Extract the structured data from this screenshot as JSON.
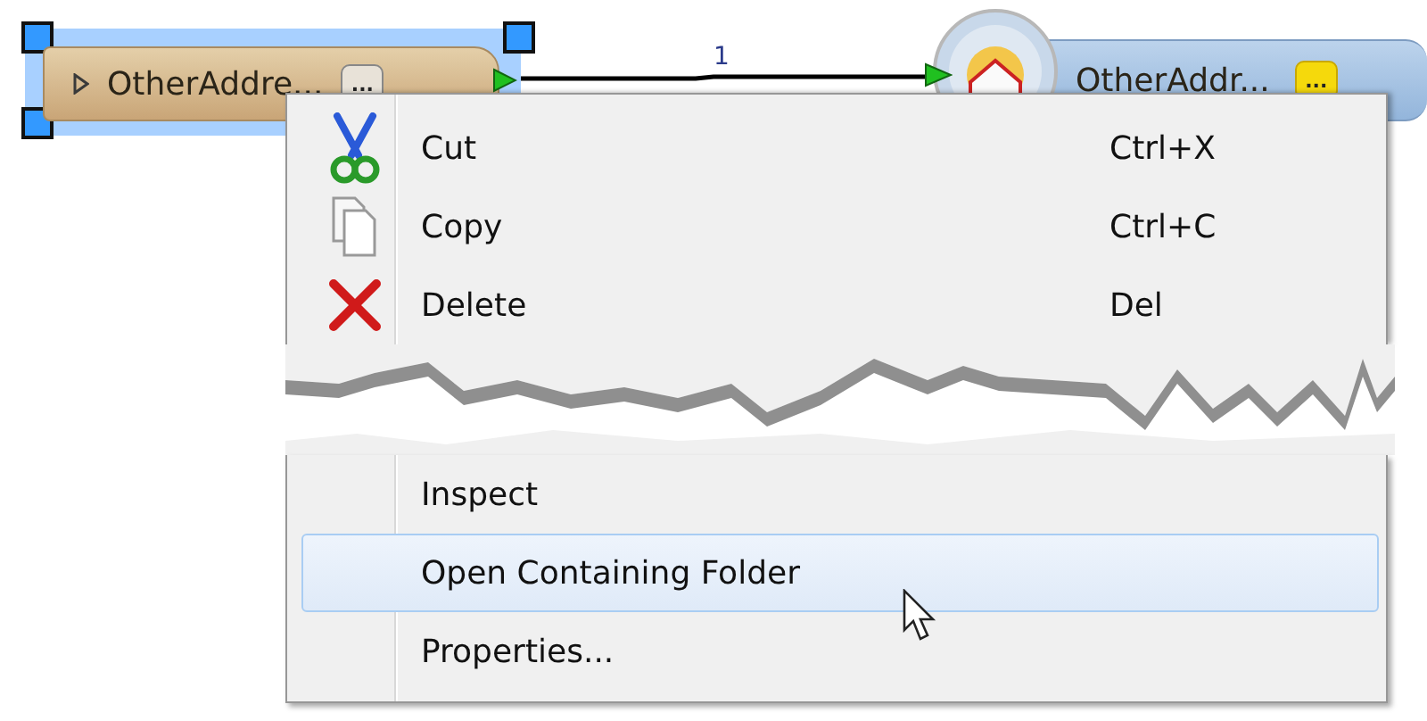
{
  "nodes": [
    {
      "kind": "transformer",
      "label": "OtherAddre...",
      "button": "...",
      "selected": true
    },
    {
      "kind": "writer",
      "label": "OtherAddr...",
      "button": "..."
    }
  ],
  "connection": {
    "label": "1"
  },
  "context_menu": {
    "top_items": [
      {
        "label": "Cut",
        "shortcut": "Ctrl+X",
        "selected": false
      },
      {
        "label": "Copy",
        "shortcut": "Ctrl+C",
        "selected": false
      },
      {
        "label": "Delete",
        "shortcut": "Del",
        "selected": false
      }
    ],
    "bottom_items": [
      {
        "label": "Inspect",
        "selected": false
      },
      {
        "label": "Open Containing Folder",
        "selected": true
      },
      {
        "label": "Properties...",
        "selected": false
      }
    ]
  }
}
